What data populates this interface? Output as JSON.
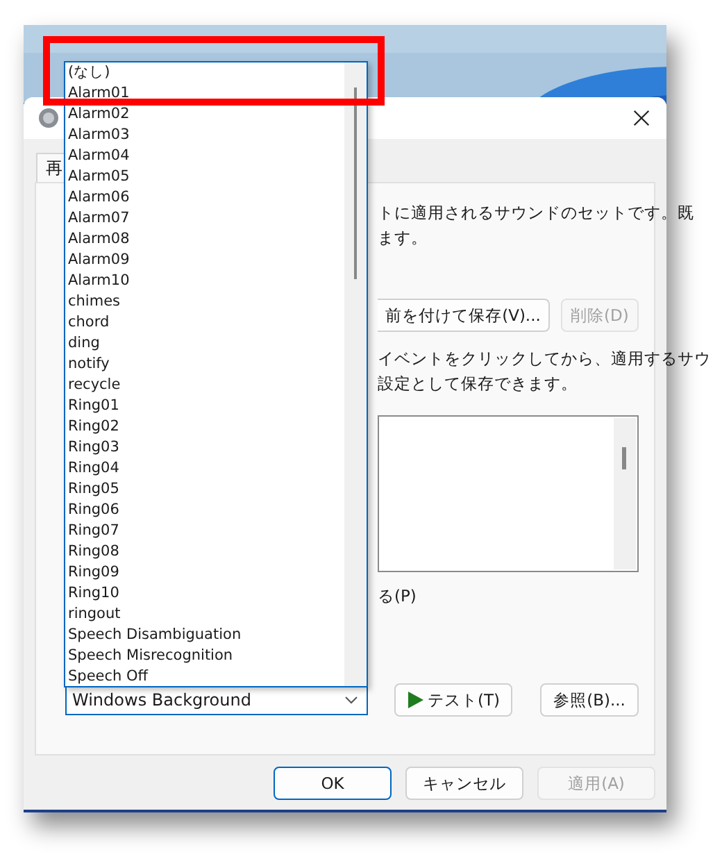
{
  "window": {
    "tab": {
      "label": "再",
      "selected": true
    }
  },
  "intro_lines": [
    "トに適用されるサウンドのセットです。既",
    "ます。"
  ],
  "scheme_buttons": [
    {
      "label": "前を付けて保存(V)...",
      "disabled": false
    },
    {
      "label": "削除(D)",
      "disabled": true
    }
  ],
  "hint_lines": [
    "イベントをクリックしてから、適用するサウ",
    "設定として保存できます。"
  ],
  "checkbox_label": "る(P)",
  "sound_select": {
    "value": "Windows Background",
    "expanded": true,
    "options": [
      {
        "label": "(なし)",
        "selected": false
      },
      {
        "label": "Alarm01",
        "selected": false
      },
      {
        "label": "Alarm02",
        "selected": false
      },
      {
        "label": "Alarm03",
        "selected": false
      },
      {
        "label": "Alarm04",
        "selected": false
      },
      {
        "label": "Alarm05",
        "selected": false
      },
      {
        "label": "Alarm06",
        "selected": false
      },
      {
        "label": "Alarm07",
        "selected": false
      },
      {
        "label": "Alarm08",
        "selected": false
      },
      {
        "label": "Alarm09",
        "selected": false
      },
      {
        "label": "Alarm10",
        "selected": false
      },
      {
        "label": "chimes",
        "selected": false
      },
      {
        "label": "chord",
        "selected": false
      },
      {
        "label": "ding",
        "selected": false
      },
      {
        "label": "notify",
        "selected": false
      },
      {
        "label": "recycle",
        "selected": false
      },
      {
        "label": "Ring01",
        "selected": false
      },
      {
        "label": "Ring02",
        "selected": false
      },
      {
        "label": "Ring03",
        "selected": false
      },
      {
        "label": "Ring04",
        "selected": false
      },
      {
        "label": "Ring05",
        "selected": false
      },
      {
        "label": "Ring06",
        "selected": false
      },
      {
        "label": "Ring07",
        "selected": false
      },
      {
        "label": "Ring08",
        "selected": false
      },
      {
        "label": "Ring09",
        "selected": false
      },
      {
        "label": "Ring10",
        "selected": false
      },
      {
        "label": "ringout",
        "selected": false
      },
      {
        "label": "Speech Disambiguation",
        "selected": false
      },
      {
        "label": "Speech Misrecognition",
        "selected": false
      },
      {
        "label": "Speech Off",
        "selected": false
      }
    ]
  },
  "test_button": {
    "label": "テスト(T)"
  },
  "browse_button": {
    "label": "参照(B)..."
  },
  "footer_buttons": [
    {
      "label": "OK",
      "default": true,
      "disabled": false
    },
    {
      "label": "キャンセル",
      "default": false,
      "disabled": false
    },
    {
      "label": "適用(A)",
      "default": false,
      "disabled": true
    }
  ],
  "annotation": {
    "kind": "highlight_box"
  }
}
